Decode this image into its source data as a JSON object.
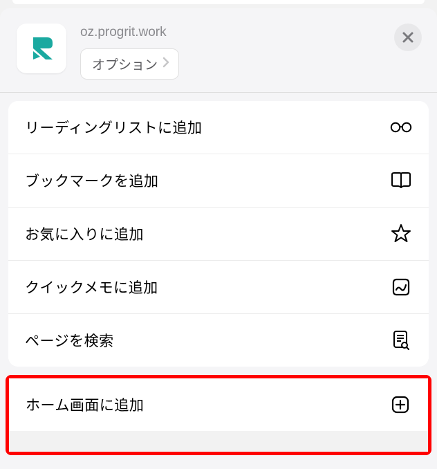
{
  "header": {
    "site_url": "oz.progrit.work",
    "options_label": "オプション",
    "app_icon_name": "progrit-logo",
    "close_label": "close"
  },
  "menu": {
    "items": [
      {
        "label": "リーディングリストに追加",
        "icon": "glasses-icon"
      },
      {
        "label": "ブックマークを追加",
        "icon": "book-icon"
      },
      {
        "label": "お気に入りに追加",
        "icon": "star-icon"
      },
      {
        "label": "クイックメモに追加",
        "icon": "quicknote-icon"
      },
      {
        "label": "ページを検索",
        "icon": "search-page-icon"
      },
      {
        "label": "ホーム画面に追加",
        "icon": "add-home-icon"
      }
    ]
  }
}
